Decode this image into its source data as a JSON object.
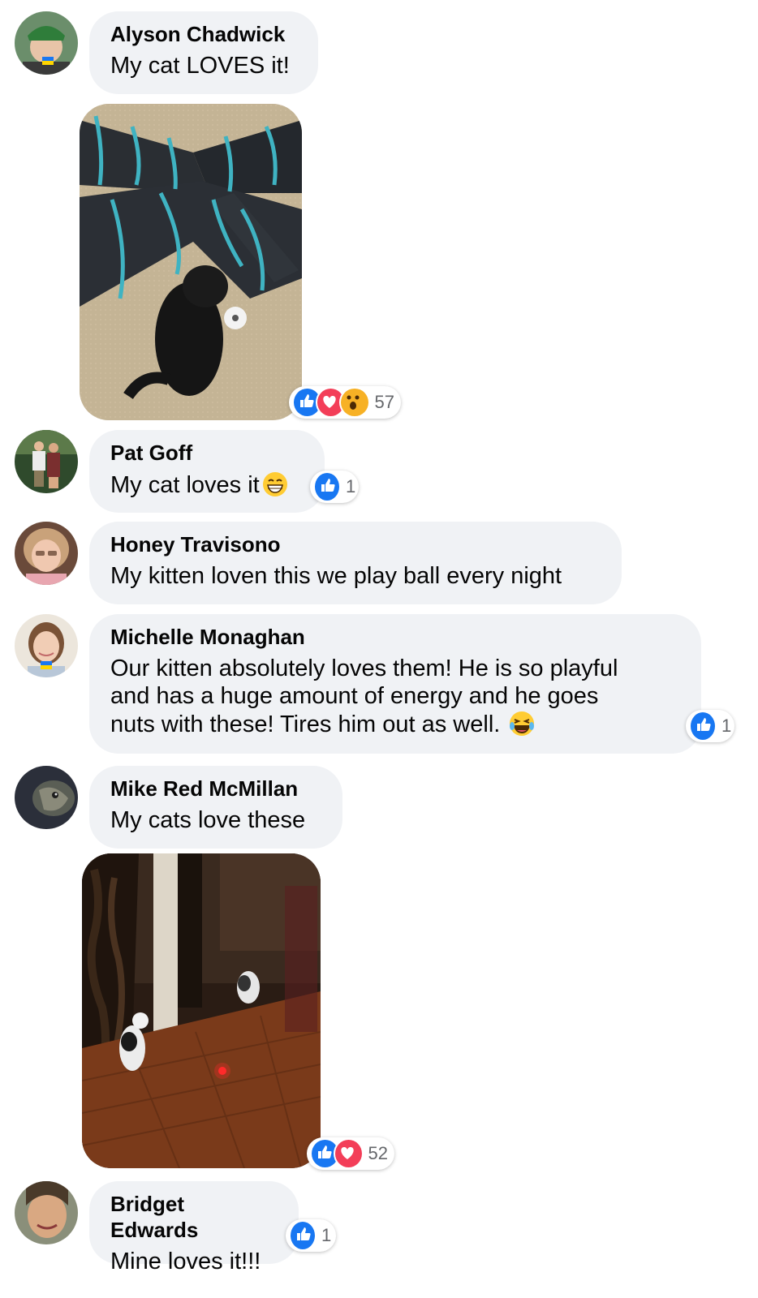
{
  "comments": [
    {
      "name": "Alyson Chadwick",
      "text": "My cat LOVES it!",
      "reactions": {
        "count": "57",
        "icons": [
          "like-icon",
          "love-icon",
          "wow-icon"
        ]
      }
    },
    {
      "name": "Pat Goff",
      "text": "My cat loves it",
      "emoji": "grin-emoji",
      "reactions": {
        "count": "1",
        "icons": [
          "like-icon"
        ]
      }
    },
    {
      "name": "Honey Travisono",
      "text": "My kitten loven this we play ball every night"
    },
    {
      "name": "Michelle Monaghan",
      "text_lines": [
        "Our kitten absolutely loves them! He is so playful",
        "and has a huge amount of energy and he goes",
        "nuts with these! Tires him out as well."
      ],
      "emoji": "laugh-emoji",
      "reactions": {
        "count": "1",
        "icons": [
          "like-icon"
        ]
      }
    },
    {
      "name": "Mike Red McMillan",
      "text": "My cats love these",
      "reactions": {
        "count": "52",
        "icons": [
          "like-icon",
          "love-icon"
        ]
      }
    },
    {
      "name": "Bridget Edwards",
      "text": "Mine loves it!!!",
      "reactions": {
        "count": "1",
        "icons": [
          "like-icon"
        ]
      }
    }
  ],
  "colors": {
    "bubble": "#f0f2f5",
    "like": "#1877f2",
    "love": "#f33e58",
    "text": "#050505",
    "meta": "#65676b"
  }
}
